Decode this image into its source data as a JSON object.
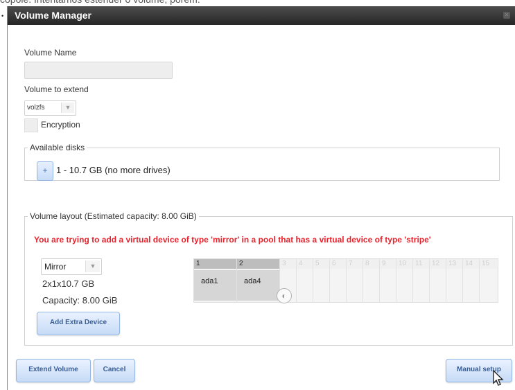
{
  "background_text": "copoie. Intentamos estender o volume, porém:",
  "dialog": {
    "title": "Volume Manager",
    "volume_name_label": "Volume Name",
    "volume_name_value": "",
    "volume_to_extend_label": "Volume to extend",
    "volume_to_extend_value": "volzfs",
    "encryption_label": "Encryption",
    "encryption_checked": false,
    "available_disks": {
      "legend": "Available disks",
      "add_button": "+",
      "text": "1 - 10.7 GB (no more drives)"
    },
    "volume_layout": {
      "legend": "Volume layout (Estimated capacity: 8.00 GiB)",
      "warning": "You are trying to add a virtual device of type 'mirror' in a pool that has a virtual device of type 'stripe'",
      "type_value": "Mirror",
      "size_text": "2x1x10.7 GB",
      "capacity_text": "Capacity: 8.00 GiB",
      "add_extra_device_button": "Add Extra Device",
      "grid": {
        "columns": [
          "1",
          "2",
          "3",
          "4",
          "5",
          "6",
          "7",
          "8",
          "9",
          "10",
          "11",
          "12",
          "13",
          "14",
          "15"
        ],
        "active_columns": 2,
        "devices": [
          "ada1",
          "ada4"
        ]
      }
    },
    "buttons": {
      "extend_volume": "Extend Volume",
      "cancel": "Cancel",
      "manual_setup": "Manual setup"
    }
  },
  "colors": {
    "title_bar": "#333333",
    "warning": "#e8212b",
    "button_bg": "#c6dbf6",
    "button_text": "#3a5f95"
  }
}
